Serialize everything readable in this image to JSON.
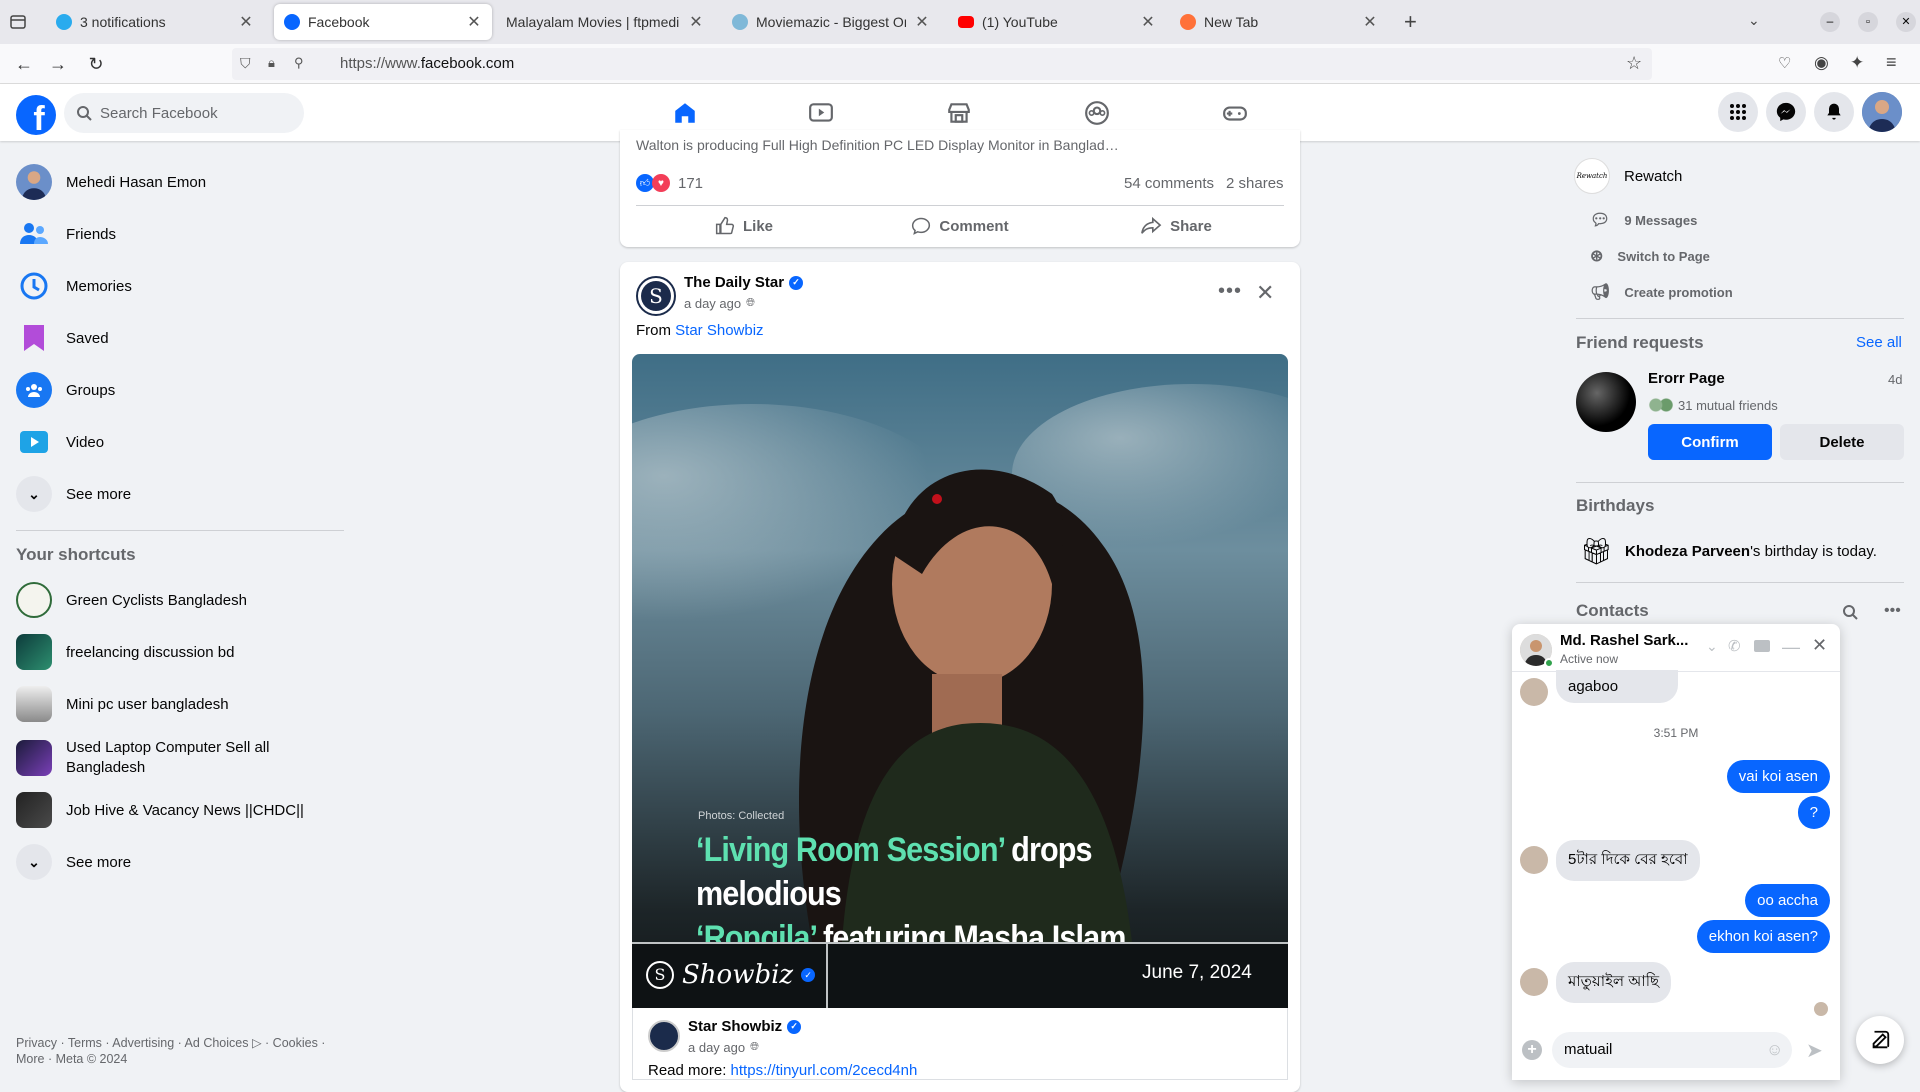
{
  "browser": {
    "tabs": [
      {
        "title": "3 notifications",
        "color": "#2aabee"
      },
      {
        "title": "Facebook",
        "color": "#0866ff"
      },
      {
        "title": "Malayalam Movies | ftpmedi",
        "color": "#ffffff"
      },
      {
        "title": "Moviemazic - Biggest Onl",
        "color": "#7fb8d8"
      },
      {
        "title": "(1) YouTube",
        "color": "#ff0000"
      },
      {
        "title": "New Tab",
        "color": "#ff7139"
      }
    ],
    "url_prefix": "https://www.",
    "url_domain": "facebook.com"
  },
  "header": {
    "search_placeholder": "Search Facebook",
    "nav_tabs": [
      "home-icon",
      "video-icon",
      "marketplace-icon",
      "groups-icon",
      "gaming-icon"
    ]
  },
  "left": {
    "profile_name": "Mehedi Hasan Emon",
    "items": [
      "Friends",
      "Memories",
      "Saved",
      "Groups",
      "Video"
    ],
    "see_more": "See more",
    "shortcuts_title": "Your shortcuts",
    "shortcuts": [
      "Green Cyclists Bangladesh",
      "freelancing discussion bd",
      "Mini pc user bangladesh",
      "Used Laptop Computer Sell all Bangladesh",
      "Job Hive & Vacancy News ||CHDC||"
    ],
    "see_more_2": "See more",
    "footer_line1": "Privacy · Terms · Advertising · Ad Choices ▷ · Cookies ·",
    "footer_line2": "More · Meta © 2024"
  },
  "post1": {
    "snippet": "Walton is producing Full High Definition PC LED Display Monitor in Banglad…",
    "reactions": "171",
    "comments": "54 comments",
    "shares": "2 shares",
    "like": "Like",
    "comment": "Comment",
    "share": "Share"
  },
  "post2": {
    "page": "The Daily Star",
    "time": "a day ago",
    "from_label": "From",
    "from_page": "Star Showbiz",
    "image": {
      "credit": "Photos: Collected",
      "headline_q1": "‘Living Room Session’",
      "headline_rest1": " drops melodious",
      "headline_q2": "‘Rongila’",
      "headline_rest2": " featuring Masha Islam",
      "brand": "Showbiz",
      "date": "June 7, 2024"
    },
    "shared_page": "Star Showbiz",
    "shared_time": "a day ago",
    "read_more": "Read more:",
    "read_more_link": "https://tinyurl.com/2cecd4nh"
  },
  "right": {
    "page_name": "Rewatch",
    "page_logo_text": "Rewatch",
    "actions": [
      "9 Messages",
      "Switch to Page",
      "Create promotion"
    ],
    "friend_requests_title": "Friend requests",
    "see_all": "See all",
    "request": {
      "name": "Erorr Page",
      "age": "4d",
      "mutual": "31 mutual friends",
      "confirm": "Confirm",
      "delete": "Delete"
    },
    "birthdays_title": "Birthdays",
    "birthday_name": "Khodeza Parveen",
    "birthday_text": "'s birthday is today.",
    "contacts_title": "Contacts"
  },
  "chat": {
    "name": "Md. Rashel Sark...",
    "status": "Active now",
    "messages": [
      {
        "from": "them",
        "text": "agaboo"
      },
      {
        "from": "time",
        "text": "3:51 PM"
      },
      {
        "from": "me",
        "text": "vai koi asen"
      },
      {
        "from": "me",
        "text": "?"
      },
      {
        "from": "them",
        "text": "5টার দিকে বের হবো"
      },
      {
        "from": "me",
        "text": "oo accha"
      },
      {
        "from": "me",
        "text": "ekhon koi asen?"
      },
      {
        "from": "them",
        "text": "মাতুয়াইল আছি"
      }
    ],
    "input_value": "matuail"
  },
  "colors": {
    "brand": "#0866ff",
    "bg": "#f0f2f5",
    "headline_accent": "#5ee0b0"
  }
}
